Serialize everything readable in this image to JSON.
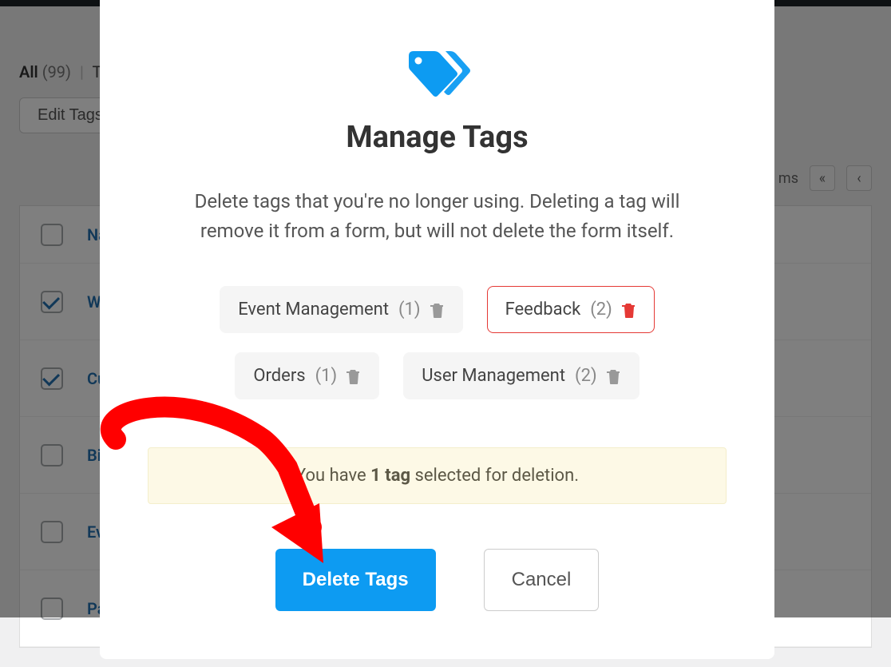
{
  "filters": {
    "all_label": "All",
    "all_count": "(99)",
    "trash_prefix": "Tra"
  },
  "toolbar": {
    "edit_tags_label": "Edit Tags",
    "items_suffix": "ms"
  },
  "table": {
    "header_name": "Nam",
    "rows": [
      {
        "label": "Web",
        "checked": true
      },
      {
        "label": "Cust",
        "checked": true
      },
      {
        "label": "Billi",
        "checked": false
      },
      {
        "label": "Even",
        "checked": false
      },
      {
        "label": "Pass",
        "checked": false
      }
    ]
  },
  "modal": {
    "title": "Manage Tags",
    "description": "Delete tags that you're no longer using. Deleting a tag will remove it from a form, but will not delete the form itself.",
    "tags": [
      {
        "name": "Event Management",
        "count": "(1)",
        "selected": false
      },
      {
        "name": "Feedback",
        "count": "(2)",
        "selected": true
      },
      {
        "name": "Orders",
        "count": "(1)",
        "selected": false
      },
      {
        "name": "User Management",
        "count": "(2)",
        "selected": false
      }
    ],
    "notice_prefix": "You have ",
    "notice_bold": "1 tag",
    "notice_suffix": " selected for deletion.",
    "delete_label": "Delete Tags",
    "cancel_label": "Cancel"
  },
  "colors": {
    "accent": "#0d9bf2",
    "danger": "#e53935"
  }
}
